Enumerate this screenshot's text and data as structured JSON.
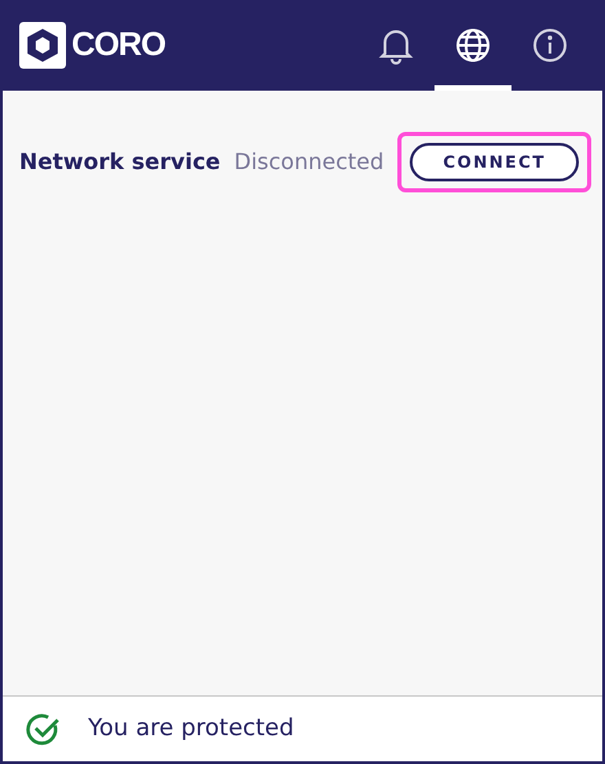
{
  "header": {
    "logo": "CORO",
    "tabs": [
      {
        "kind": "bell",
        "selected": false
      },
      {
        "kind": "globe",
        "selected": true
      },
      {
        "kind": "info",
        "selected": false
      }
    ]
  },
  "service": {
    "name": "Network service",
    "status": "Disconnected",
    "button": {
      "label": "CONNECT",
      "highlighted": true
    }
  },
  "status_bar": {
    "text": "You are protected",
    "protected": true
  }
}
